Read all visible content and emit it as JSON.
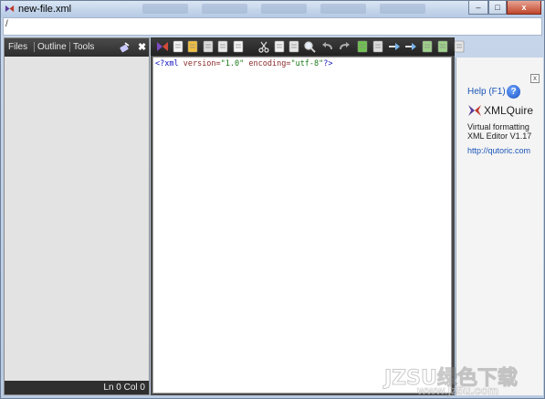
{
  "window": {
    "title": "new-file.xml"
  },
  "titlebar": {
    "buttons": {
      "minimize": "–",
      "maximize": "□",
      "close": "x"
    }
  },
  "pathbar": {
    "path": "/"
  },
  "left_panel": {
    "tabs": [
      {
        "label": "Files"
      },
      {
        "label": "Outline"
      },
      {
        "label": "Tools"
      }
    ],
    "close_label": "✖",
    "status": "Ln 0 Col 0"
  },
  "toolbar": {
    "buttons": [
      "logo",
      "new-file",
      "open-folder",
      "save",
      "save-as",
      "print",
      "cut",
      "copy",
      "paste",
      "find",
      "undo",
      "redo",
      "insert-element",
      "insert-child",
      "move-up",
      "move-down",
      "indent",
      "outdent",
      "format",
      "validate",
      "edit"
    ]
  },
  "editor": {
    "xml_open": "<?xml",
    "version_attr": "version=",
    "version_val": "\"1.0\"",
    "encoding_attr": "encoding=",
    "encoding_val": "\"utf-8\"",
    "xml_close": "?>"
  },
  "help_panel": {
    "close_label": "x",
    "help_label": "Help (F1)",
    "help_icon": "?",
    "product_name": "XMLQuire",
    "desc_line1": "Virtual formatting",
    "desc_line2": "XML Editor V1.17",
    "website": "http://qutoric.com"
  },
  "watermark": {
    "big": "JZSU绿色下载",
    "small": "www.jz5u.com"
  },
  "colors": {
    "accent_link": "#1a55b8",
    "toolbar_bg": "#2e2e2e",
    "logo_red": "#c0392b",
    "logo_purple": "#5b3a9a"
  }
}
